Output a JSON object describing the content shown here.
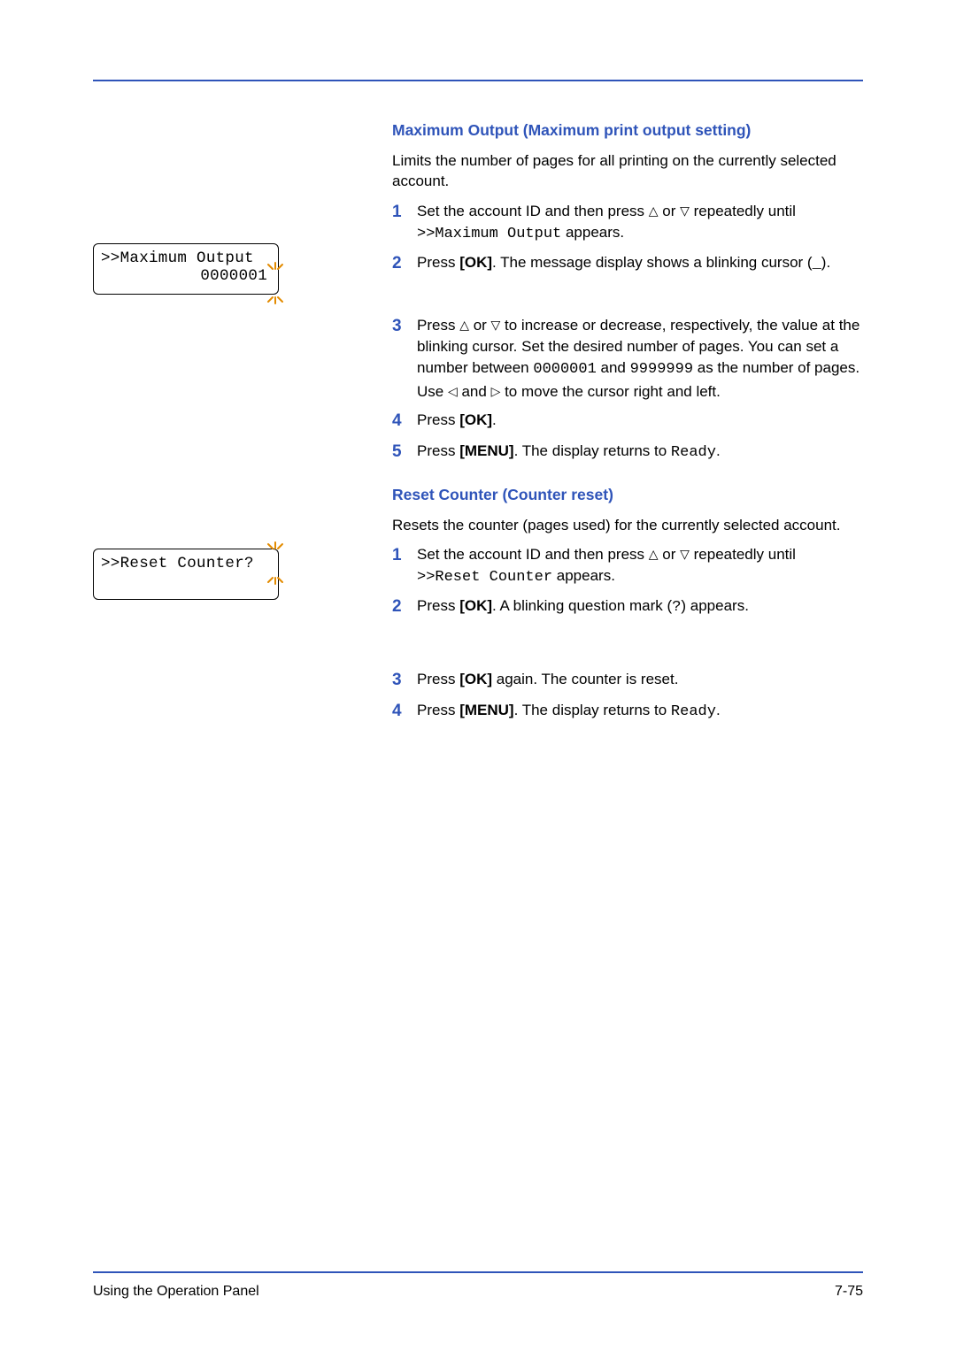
{
  "section1": {
    "heading": "Maximum Output (Maximum print output setting)",
    "intro": "Limits the number of pages for all printing on the currently selected account.",
    "steps": {
      "s1a": "Set the account ID and then press ",
      "s1b": " or ",
      "s1c": " repeatedly until ",
      "s1d": ">>Maximum Output",
      "s1e": " appears.",
      "s2a": "Press ",
      "s2b": "[OK]",
      "s2c": ". The message display shows a blinking cursor (",
      "s2d": "_",
      "s2e": ").",
      "s3a": "Press ",
      "s3b": " or ",
      "s3c": " to increase or decrease, respectively, the value at the blinking cursor. Set the desired number of pages. You can set a number between ",
      "s3d": "0000001",
      "s3e": " and ",
      "s3f": "9999999",
      "s3g": " as the number of pages. Use ",
      "s3h": " and ",
      "s3i": " to move the cursor right and left.",
      "s4a": "Press ",
      "s4b": "[OK]",
      "s4c": ".",
      "s5a": "Press ",
      "s5b": "[MENU]",
      "s5c": ". The display returns to ",
      "s5d": "Ready",
      "s5e": "."
    },
    "lcd": {
      "line1": ">>Maximum Output",
      "line2_prefix": "000000",
      "line2_blink": "1"
    }
  },
  "section2": {
    "heading": "Reset Counter (Counter reset)",
    "intro": "Resets the counter (pages used) for the currently selected account.",
    "steps": {
      "s1a": "Set the account ID and then press ",
      "s1b": " or ",
      "s1c": " repeatedly until ",
      "s1d": ">>Reset Counter",
      "s1e": " appears.",
      "s2a": "Press ",
      "s2b": "[OK]",
      "s2c": ". A blinking question mark (",
      "s2d": "?",
      "s2e": ") appears.",
      "s3a": "Press ",
      "s3b": "[OK]",
      "s3c": " again. The counter is reset.",
      "s4a": "Press ",
      "s4b": "[MENU]",
      "s4c": ". The display returns to ",
      "s4d": "Ready",
      "s4e": "."
    },
    "lcd": {
      "line1_prefix": ">>Reset Counter",
      "line1_blink": "?"
    }
  },
  "glyphs": {
    "up": "△",
    "down": "▽",
    "left": "◁",
    "right": "▷"
  },
  "footer": {
    "left": "Using the Operation Panel",
    "right": "7-75"
  },
  "nums": {
    "n1": "1",
    "n2": "2",
    "n3": "3",
    "n4": "4",
    "n5": "5"
  }
}
